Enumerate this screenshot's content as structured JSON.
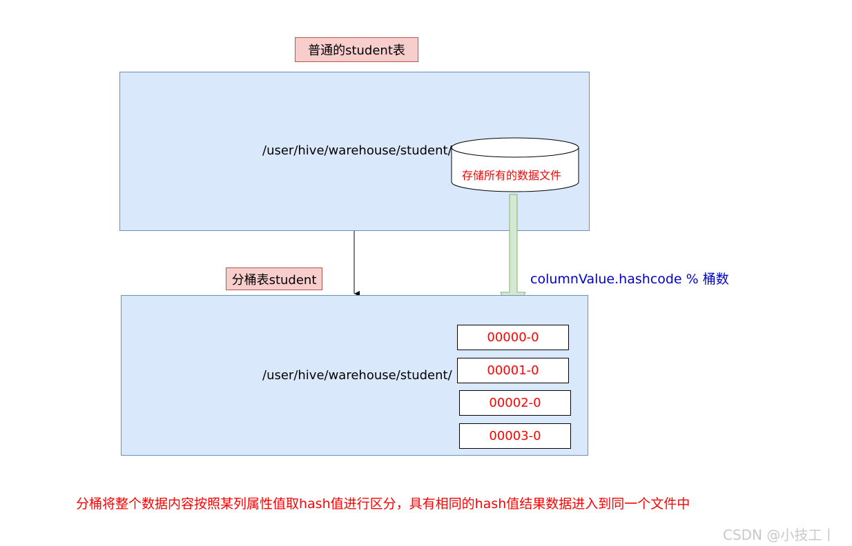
{
  "normal_table": {
    "label": "普通的student表",
    "path": "/user/hive/warehouse/student/",
    "storage_label": "存储所有的数据文件"
  },
  "bucket_table": {
    "label": "分桶表student",
    "path": "/user/hive/warehouse/student/",
    "files": [
      "00000-0",
      "00001-0",
      "00002-0",
      "00003-0"
    ]
  },
  "formula": "columnValue.hashcode % 桶数",
  "caption": "分桶将整个数据内容按照某列属性值取hash值进行区分，具有相同的hash值结果数据进入到同一个文件中",
  "watermark": "CSDN @小技工丨",
  "colors": {
    "label_fill": "#f8cecc",
    "label_border": "#b85450",
    "box_fill": "#dae8fc",
    "box_border": "#6c8ebf",
    "arrow_fill": "#d5e8d4",
    "arrow_border": "#82b366",
    "accent_red": "#ff0000",
    "formula_blue": "#0000cc"
  }
}
